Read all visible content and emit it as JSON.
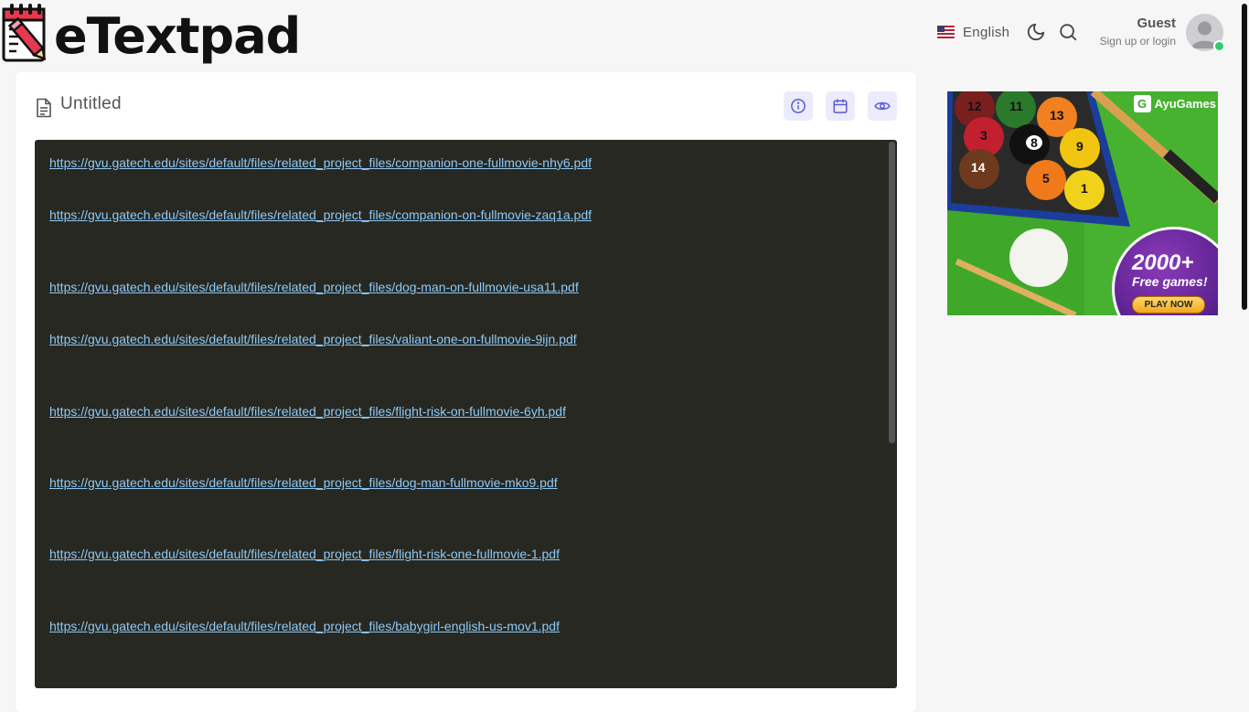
{
  "header": {
    "logo_text": "eTextpad",
    "language": {
      "label": "English",
      "flag": "us-flag"
    },
    "icons": {
      "theme": "moon-icon",
      "search": "search-icon"
    },
    "user": {
      "name": "Guest",
      "subtitle": "Sign up or login",
      "status_color": "#2ecc71"
    }
  },
  "document": {
    "title": "Untitled",
    "toolbar": [
      "info-icon",
      "calendar-icon",
      "eye-icon"
    ],
    "links": [
      "https://gvu.gatech.edu/sites/default/files/related_project_files/companion-one-fullmovie-nhy6.pdf",
      "https://gvu.gatech.edu/sites/default/files/related_project_files/companion-on-fullmovie-zaq1a.pdf",
      "https://gvu.gatech.edu/sites/default/files/related_project_files/dog-man-on-fullmovie-usa11.pdf",
      "https://gvu.gatech.edu/sites/default/files/related_project_files/valiant-one-on-fullmovie-9ijn.pdf",
      "https://gvu.gatech.edu/sites/default/files/related_project_files/flight-risk-on-fullmovie-6yh.pdf",
      "https://gvu.gatech.edu/sites/default/files/related_project_files/dog-man-fullmovie-mko9.pdf",
      "https://gvu.gatech.edu/sites/default/files/related_project_files/flight-risk-one-fullmovie-1.pdf",
      "https://gvu.gatech.edu/sites/default/files/related_project_files/babygirl-english-us-mov1.pdf"
    ]
  },
  "ad": {
    "brand": "AyuGames",
    "headline": "2000+",
    "subline": "Free games!",
    "cta": "PLAY NOW",
    "balls": [
      "12",
      "11",
      "13",
      "3",
      "8",
      "9",
      "14",
      "5",
      "1"
    ]
  },
  "colors": {
    "editor_bg": "#272822",
    "link": "#8ec9f5",
    "accent_btn": "#ebebfb",
    "accent_icon": "#5b5bd6"
  }
}
